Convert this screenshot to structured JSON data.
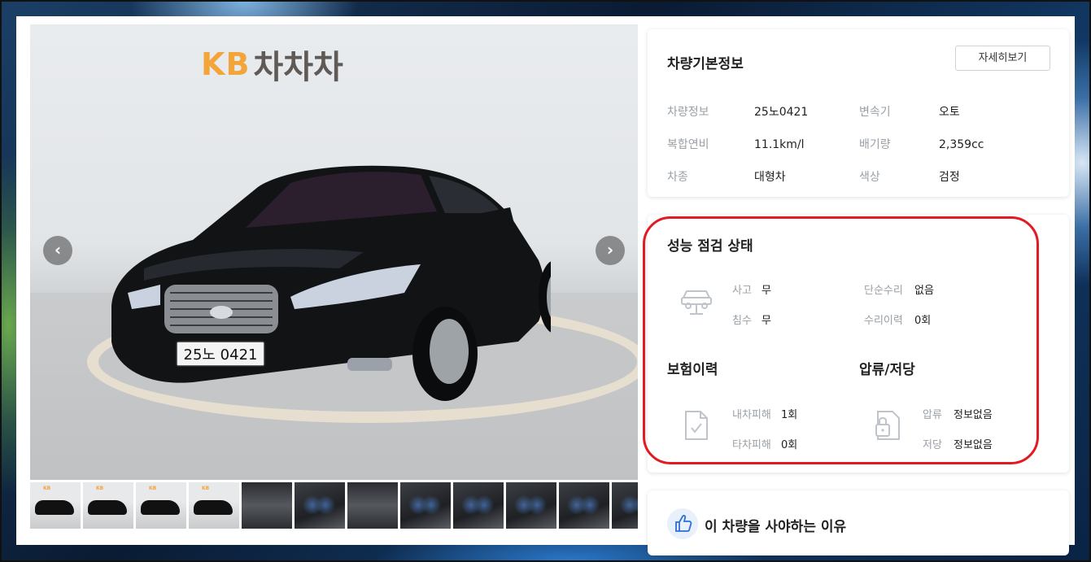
{
  "gallery": {
    "brand_kb": "KB",
    "brand_name": "차차차",
    "plate": "25노 0421",
    "thumbnails": [
      "ext",
      "ext",
      "ext",
      "ext",
      "eng",
      "int",
      "int",
      "int",
      "int",
      "int",
      "int",
      "int"
    ]
  },
  "basic_info": {
    "title": "차량기본정보",
    "detail_button": "자세히보기",
    "rows": [
      {
        "label1": "차량정보",
        "value1": "25노0421",
        "label2": "변속기",
        "value2": "오토"
      },
      {
        "label1": "복합연비",
        "value1": "11.1km/l",
        "label2": "배기량",
        "value2": "2,359cc"
      },
      {
        "label1": "차종",
        "value1": "대형차",
        "label2": "색상",
        "value2": "검정"
      }
    ]
  },
  "performance": {
    "title": "성능 점검 상태",
    "accident_label": "사고",
    "accident_value": "무",
    "simple_repair_label": "단순수리",
    "simple_repair_value": "없음",
    "flood_label": "침수",
    "flood_value": "무",
    "repair_history_label": "수리이력",
    "repair_history_value": "0회",
    "insurance_title": "보험이력",
    "own_damage_label": "내차피해",
    "own_damage_value": "1회",
    "other_damage_label": "타차피해",
    "other_damage_value": "0회",
    "seizure_title": "압류/저당",
    "seizure_label": "압류",
    "seizure_value": "정보없음",
    "mortgage_label": "저당",
    "mortgage_value": "정보없음"
  },
  "reason": {
    "text": "이 차량을 사야하는 이유"
  },
  "colors": {
    "highlight": "#e21b23",
    "accent_blue": "#2e6fd8"
  }
}
